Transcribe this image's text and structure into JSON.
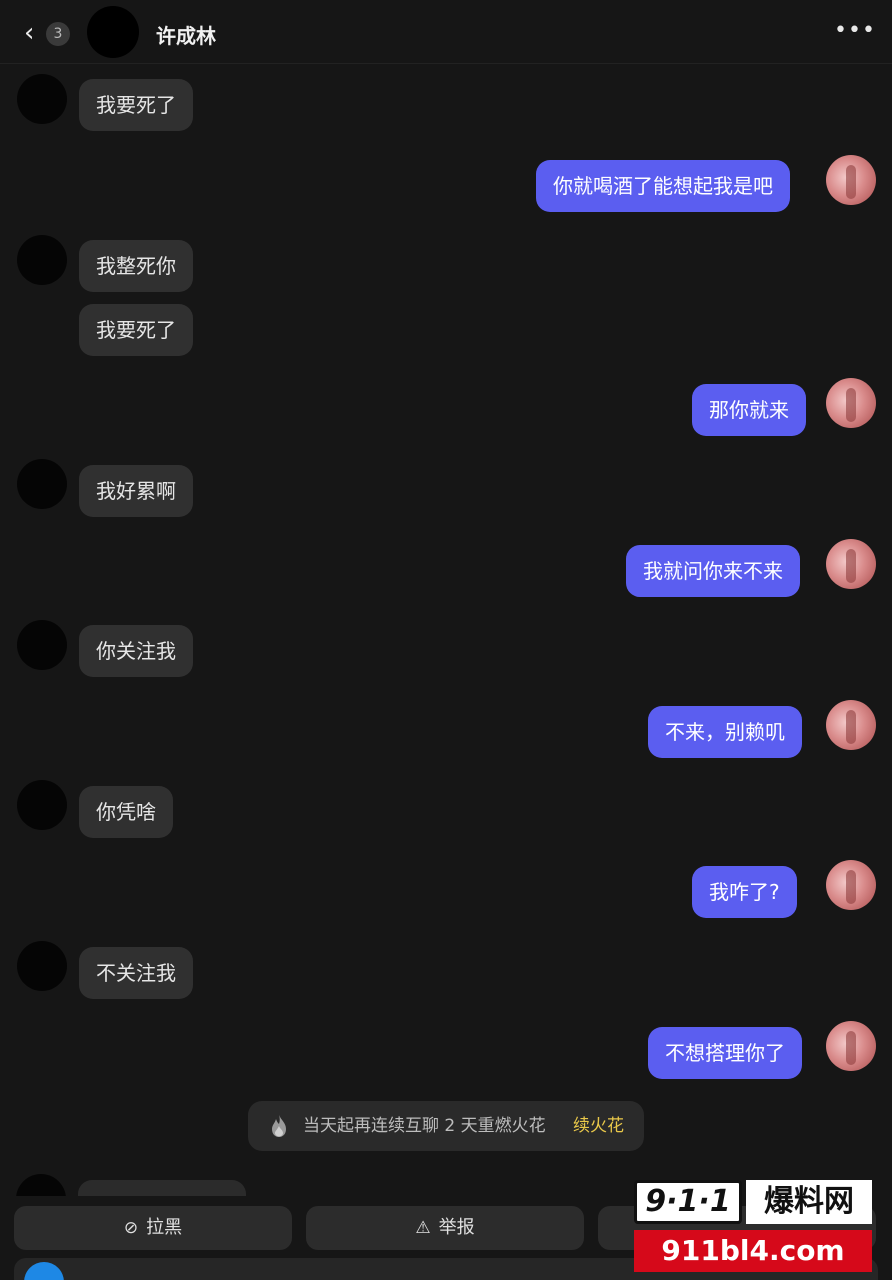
{
  "header": {
    "back_icon": "chevron-left-icon",
    "unread_count": "3",
    "contact_name": "许成林",
    "more_icon": "more-dots-icon",
    "more_glyph": "•••"
  },
  "messages": [
    {
      "side": "in",
      "text": "我要死了"
    },
    {
      "side": "out",
      "text": "你就喝酒了能想起我是吧"
    },
    {
      "side": "in",
      "text": "我整死你"
    },
    {
      "side": "in",
      "text": "我要死了"
    },
    {
      "side": "out",
      "text": "那你就来"
    },
    {
      "side": "in",
      "text": "我好累啊"
    },
    {
      "side": "out",
      "text": "我就问你来不来"
    },
    {
      "side": "in",
      "text": "你关注我"
    },
    {
      "side": "out",
      "text": "不来，别赖叽"
    },
    {
      "side": "in",
      "text": "你凭啥"
    },
    {
      "side": "out",
      "text": "我咋了?"
    },
    {
      "side": "in",
      "text": "不关注我"
    },
    {
      "side": "out",
      "text": "不想搭理你了"
    }
  ],
  "notice": {
    "icon": "fire-icon",
    "text": "当天起再连续互聊 2 天重燃火花",
    "link": "续火花"
  },
  "actions": {
    "block_label": "拉黑",
    "block_icon": "block-icon",
    "report_label": "举报",
    "report_icon": "warning-icon"
  },
  "watermark": {
    "brand_number": "9·1·1",
    "brand_name": "爆料网",
    "url": "911bl4.com"
  },
  "colors": {
    "background": "#161616",
    "incoming_bubble": "#303030",
    "outgoing_bubble": "#5b5ef0",
    "notice_link": "#e9c84a",
    "watermark_red": "#d6091a"
  }
}
